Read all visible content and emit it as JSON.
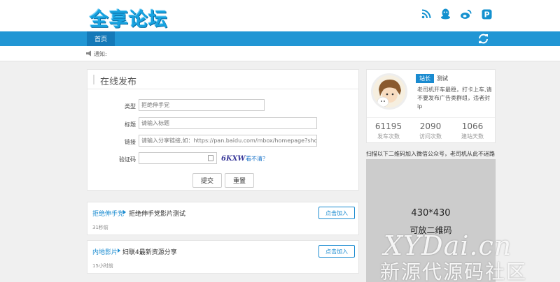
{
  "site": {
    "logo_text": "全享论坛"
  },
  "header": {
    "social_icons": [
      "rss-icon",
      "qq-icon",
      "weibo-icon",
      "pinterest-icon"
    ]
  },
  "nav": {
    "home_label": "首页",
    "refresh_icon": "refresh-icon"
  },
  "notice": {
    "label": "通知:"
  },
  "form": {
    "title": "在线发布",
    "type_label": "类型",
    "type_value": "拒绝伸手党",
    "title_label": "标题",
    "title_placeholder": "请输入标题",
    "link_label": "链接",
    "link_placeholder": "请输入分享链接,如：https://pan.baidu.com/mbox/homepage?short=xxx",
    "captcha_label": "验证码",
    "captcha_code": "6KXW",
    "captcha_refresh": "看不清？",
    "submit_label": "提交",
    "reset_label": "重置"
  },
  "posts": [
    {
      "category": "拒绝伸手党",
      "title": "拒绝伸手党影片测试",
      "time": "31秒前",
      "action": "点击加入"
    },
    {
      "category": "内地影片",
      "title": "妇联4最新资源分享",
      "time": "15小时前",
      "action": "点击加入"
    }
  ],
  "profile": {
    "role": "站长",
    "name": "测试",
    "bio": "老司机开车最稳，打卡上车,请不要发布广告类群组，违者封ip",
    "stats": [
      {
        "value": "61195",
        "label": "发车次数"
      },
      {
        "value": "2090",
        "label": "访问次数"
      },
      {
        "value": "1066",
        "label": "建站天数"
      }
    ]
  },
  "qr": {
    "caption": "扫描以下二维码加入微信公众号，老司机从此不迷路",
    "size_text": "430*430",
    "placeholder_text": "可放二维码"
  },
  "watermark": {
    "line1": "XYDai.cn",
    "line2": "新源代源码社区"
  },
  "colors": {
    "primary": "#2196d4",
    "nav_active": "#1479b8",
    "link": "#1a8bd0"
  }
}
